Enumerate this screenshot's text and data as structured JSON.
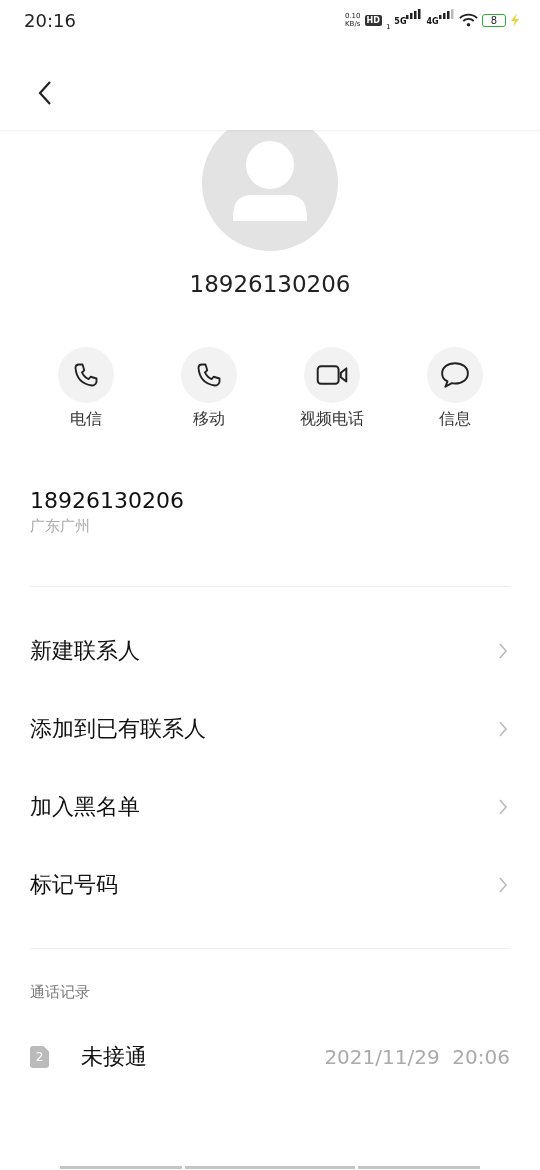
{
  "status_bar": {
    "time": "20:16",
    "speed_value": "0.10",
    "speed_unit": "KB/s",
    "hd": "HD",
    "hd_sim": "1",
    "net_1": "5G",
    "net_2": "4G",
    "battery": "8"
  },
  "contact": {
    "number": "18926130206"
  },
  "actions": [
    {
      "kind": "phone",
      "label": "电信"
    },
    {
      "kind": "phone",
      "label": "移动"
    },
    {
      "kind": "video",
      "label": "视频电话"
    },
    {
      "kind": "message",
      "label": "信息"
    }
  ],
  "number_info": {
    "number": "18926130206",
    "location": "广东广州"
  },
  "menu": [
    {
      "label": "新建联系人"
    },
    {
      "label": "添加到已有联系人"
    },
    {
      "label": "加入黑名单"
    },
    {
      "label": "标记号码"
    }
  ],
  "call_log": {
    "title": "通话记录",
    "entries": [
      {
        "sim": "2",
        "status": "未接通",
        "time": "2021/11/29  20:06"
      }
    ]
  }
}
